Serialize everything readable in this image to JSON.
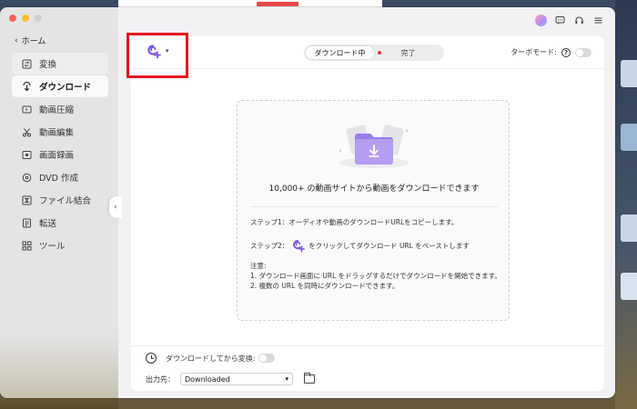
{
  "sidebar": {
    "home_label": "ホーム",
    "items": [
      {
        "label": "変換",
        "icon": "convert-icon",
        "state": "hover"
      },
      {
        "label": "ダウンロード",
        "icon": "download-icon",
        "state": "active"
      },
      {
        "label": "動画圧縮",
        "icon": "compress-icon",
        "state": ""
      },
      {
        "label": "動画編集",
        "icon": "scissors-icon",
        "state": ""
      },
      {
        "label": "画面録画",
        "icon": "screen-record-icon",
        "state": ""
      },
      {
        "label": "DVD 作成",
        "icon": "dvd-icon",
        "state": ""
      },
      {
        "label": "ファイル結合",
        "icon": "merge-icon",
        "state": ""
      },
      {
        "label": "転送",
        "icon": "transfer-icon",
        "state": ""
      },
      {
        "label": "ツール",
        "icon": "tools-icon",
        "state": ""
      }
    ]
  },
  "header": {
    "tabs": [
      {
        "label": "ダウンロード中",
        "active": true
      },
      {
        "label": "完了",
        "active": false
      }
    ],
    "turbo_label": "ターボモード:",
    "turbo_on": false
  },
  "dropzone": {
    "title": "10,000+ の動画サイトから動画をダウンロードできます",
    "step1": "ステップ1：オーディオや動画のダウンロードURLをコピーします。",
    "step2_prefix": "ステップ2：",
    "step2_suffix": "をクリックしてダウンロード URL をペーストします",
    "note_title": "注意:",
    "note1": "1. ダウンロード画面に URL をドラッグするだけでダウンロードを開始できます。",
    "note2": "2. 複数の URL を同時にダウンロードできます。"
  },
  "footer": {
    "convert_after_label": "ダウンロードしてから変換:",
    "convert_after_on": false,
    "output_label": "出力先：",
    "output_value": "Downloaded"
  },
  "colors": {
    "accent": "#7b55e0",
    "highlight_box": "#e8141b",
    "folder": "#9b7bea"
  }
}
